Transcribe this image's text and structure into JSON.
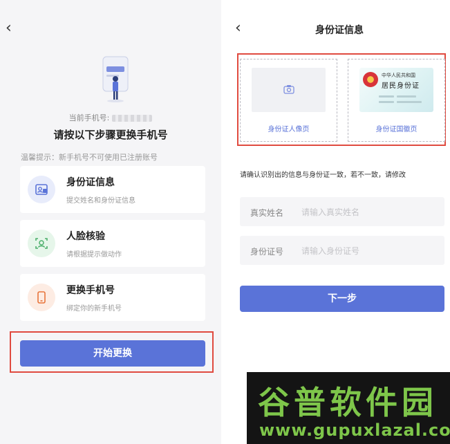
{
  "left": {
    "back_glyph": "‹",
    "current_phone_label": "当前手机号:",
    "main_title": "请按以下步骤更换手机号",
    "tip": "温馨提示：新手机号不可使用已注册账号",
    "steps": [
      {
        "title": "身份证信息",
        "subtitle": "提交姓名和身份证信息",
        "icon": "id-card-icon",
        "icon_color": "#5a73d8"
      },
      {
        "title": "人脸核验",
        "subtitle": "请根据提示做动作",
        "icon": "face-scan-icon",
        "icon_color": "#4caf6b"
      },
      {
        "title": "更换手机号",
        "subtitle": "绑定你的新手机号",
        "icon": "phone-icon",
        "icon_color": "#e8743a"
      }
    ],
    "start_button": "开始更换"
  },
  "right": {
    "back_glyph": "‹",
    "title": "身份证信息",
    "front_label": "身份证人像页",
    "back_label": "身份证国徽页",
    "idcard_line1": "中华人民共和国",
    "idcard_line2": "居民身份证",
    "confirm_text": "请确认识别出的信息与身份证一致，若不一致，请修改",
    "fields": [
      {
        "label": "真实姓名",
        "placeholder": "请输入真实姓名"
      },
      {
        "label": "身份证号",
        "placeholder": "请输入身份证号"
      }
    ],
    "next_button": "下一步"
  },
  "watermark": {
    "cn": "谷普软件园",
    "url": "www.gupuxlazal.com"
  },
  "colors": {
    "accent": "#5a73d8",
    "highlight": "#e04a3f"
  }
}
